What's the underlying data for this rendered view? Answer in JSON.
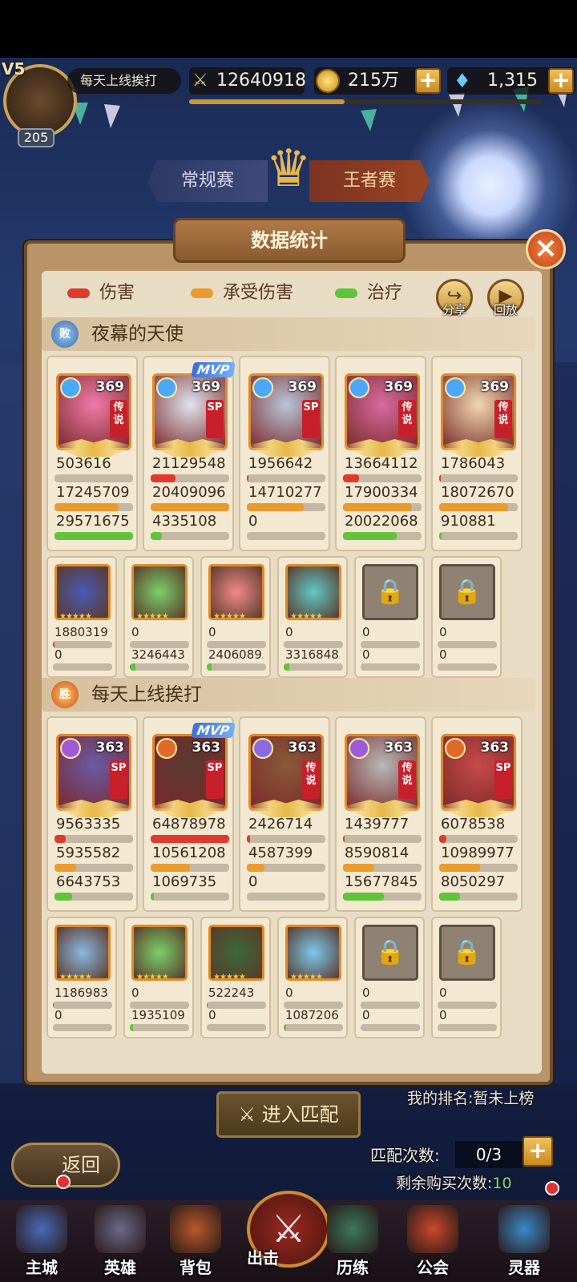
{
  "player": {
    "vip": "V5",
    "level": "205",
    "name": "每天上线挨打",
    "power": "12640918",
    "gold": "215万",
    "gems": "1,315"
  },
  "tabs": [
    "常规赛",
    "王者赛"
  ],
  "panel": {
    "title": "数据统计",
    "close": "×"
  },
  "legend": [
    {
      "label": "伤害",
      "color": "#e03a2e"
    },
    {
      "label": "承受伤害",
      "color": "#eb9a2e"
    },
    {
      "label": "治疗",
      "color": "#5fc43a"
    }
  ],
  "buttons": {
    "share": "分享",
    "replay": "回放"
  },
  "teams": [
    {
      "result": "败",
      "name": "夜幕的天使",
      "heroes": [
        {
          "level": "369",
          "rank": "传说",
          "mvp": "",
          "damage": "503616",
          "taken": "17245709",
          "heal": "29571675",
          "dmg_frac": 0.0,
          "taken_frac": 0.82,
          "heal_frac": 1.0,
          "element": "#4aa8ff",
          "art": "#f07aa8"
        },
        {
          "level": "369",
          "rank": "SP",
          "mvp": "MVP",
          "damage": "21129548",
          "taken": "20409096",
          "heal": "4335108",
          "dmg_frac": 0.32,
          "taken_frac": 1.0,
          "heal_frac": 0.14,
          "element": "#4aa8ff",
          "art": "#dfe4ee"
        },
        {
          "level": "369",
          "rank": "SP",
          "mvp": "",
          "damage": "1956642",
          "taken": "14710277",
          "heal": "0",
          "dmg_frac": 0.02,
          "taken_frac": 0.72,
          "heal_frac": 0.0,
          "element": "#4aa8ff",
          "art": "#b8c4d8"
        },
        {
          "level": "369",
          "rank": "传说",
          "mvp": "",
          "damage": "13664112",
          "taken": "17900334",
          "heal": "20022068",
          "dmg_frac": 0.2,
          "taken_frac": 0.88,
          "heal_frac": 0.68,
          "element": "#4aa8ff",
          "art": "#d86aa0"
        },
        {
          "level": "369",
          "rank": "传说",
          "mvp": "",
          "damage": "1786043",
          "taken": "18072670",
          "heal": "910881",
          "dmg_frac": 0.02,
          "taken_frac": 0.88,
          "heal_frac": 0.03,
          "element": "#4aa8ff",
          "art": "#f0d8b0"
        }
      ],
      "pets": [
        {
          "damage": "1880319",
          "heal": "0",
          "dmg_frac": 0.03,
          "heal_frac": 0.0,
          "locked": false,
          "art": "#4a5ab8"
        },
        {
          "damage": "0",
          "heal": "3246443",
          "dmg_frac": 0.0,
          "heal_frac": 0.1,
          "locked": false,
          "art": "#7ad06a"
        },
        {
          "damage": "0",
          "heal": "2406089",
          "dmg_frac": 0.0,
          "heal_frac": 0.08,
          "locked": false,
          "art": "#f08a8a"
        },
        {
          "damage": "0",
          "heal": "3316848",
          "dmg_frac": 0.0,
          "heal_frac": 0.1,
          "locked": false,
          "art": "#60c8c8"
        },
        {
          "damage": "0",
          "heal": "0",
          "dmg_frac": 0.0,
          "heal_frac": 0.0,
          "locked": true,
          "art": ""
        },
        {
          "damage": "0",
          "heal": "0",
          "dmg_frac": 0.0,
          "heal_frac": 0.0,
          "locked": true,
          "art": ""
        },
        {
          "damage": "0",
          "heal": "0",
          "dmg_frac": 0.0,
          "heal_frac": 0.0,
          "locked": true,
          "art": ""
        }
      ]
    },
    {
      "result": "胜",
      "name": "每天上线挨打",
      "heroes": [
        {
          "level": "363",
          "rank": "SP",
          "mvp": "",
          "damage": "9563335",
          "taken": "5935582",
          "heal": "6643753",
          "dmg_frac": 0.14,
          "taken_frac": 0.28,
          "heal_frac": 0.22,
          "element": "#a05ad8",
          "art": "#6a5aa8"
        },
        {
          "level": "363",
          "rank": "SP",
          "mvp": "MVP",
          "damage": "64878978",
          "taken": "10561208",
          "heal": "1069735",
          "dmg_frac": 1.0,
          "taken_frac": 0.5,
          "heal_frac": 0.04,
          "element": "#e06a2a",
          "art": "#5a3a30"
        },
        {
          "level": "363",
          "rank": "传说",
          "mvp": "",
          "damage": "2426714",
          "taken": "4587399",
          "heal": "0",
          "dmg_frac": 0.04,
          "taken_frac": 0.22,
          "heal_frac": 0.0,
          "element": "#8a6ae0",
          "art": "#8a5a3a"
        },
        {
          "level": "363",
          "rank": "传说",
          "mvp": "",
          "damage": "1439777",
          "taken": "8590814",
          "heal": "15677845",
          "dmg_frac": 0.02,
          "taken_frac": 0.4,
          "heal_frac": 0.52,
          "element": "#a05ad8",
          "art": "#b8b8b8"
        },
        {
          "level": "363",
          "rank": "SP",
          "mvp": "",
          "damage": "6078538",
          "taken": "10989977",
          "heal": "8050297",
          "dmg_frac": 0.09,
          "taken_frac": 0.52,
          "heal_frac": 0.27,
          "element": "#e06a2a",
          "art": "#c84a4a"
        }
      ],
      "pets": [
        {
          "damage": "1186983",
          "heal": "0",
          "dmg_frac": 0.02,
          "heal_frac": 0.0,
          "locked": false,
          "art": "#8ab8e0"
        },
        {
          "damage": "0",
          "heal": "1935109",
          "dmg_frac": 0.0,
          "heal_frac": 0.06,
          "locked": false,
          "art": "#7ad06a"
        },
        {
          "damage": "522243",
          "heal": "0",
          "dmg_frac": 0.01,
          "heal_frac": 0.0,
          "locked": false,
          "art": "#3a6a3a"
        },
        {
          "damage": "0",
          "heal": "1087206",
          "dmg_frac": 0.0,
          "heal_frac": 0.04,
          "locked": false,
          "art": "#7ac8f0"
        },
        {
          "damage": "0",
          "heal": "0",
          "dmg_frac": 0.0,
          "heal_frac": 0.0,
          "locked": true,
          "art": ""
        },
        {
          "damage": "0",
          "heal": "0",
          "dmg_frac": 0.0,
          "heal_frac": 0.0,
          "locked": true,
          "art": ""
        },
        {
          "damage": "0",
          "heal": "0",
          "dmg_frac": 0.0,
          "heal_frac": 0.0,
          "locked": true,
          "art": ""
        }
      ]
    }
  ],
  "bottom": {
    "match_button": "进入匹配",
    "my_rank": "我的排名:暂未上榜",
    "back": "返回",
    "match_count_label": "匹配次数:",
    "match_count": "0/3",
    "buy_label": "剩余购买次数:",
    "buy_count": "10"
  },
  "nav": [
    {
      "label": "主城",
      "icon": "castle-icon",
      "color": "#4a6ab8"
    },
    {
      "label": "英雄",
      "icon": "helmet-icon",
      "color": "#6a6a8a"
    },
    {
      "label": "背包",
      "icon": "backpack-icon",
      "color": "#b85a2a"
    },
    {
      "label": "出击",
      "icon": "crossed-swords-icon",
      "color": "#9a2a20"
    },
    {
      "label": "历练",
      "icon": "tree-icon",
      "color": "#3a7a5a"
    },
    {
      "label": "公会",
      "icon": "guild-banner-icon",
      "color": "#c84a2a"
    },
    {
      "label": "灵器",
      "icon": "orb-icon",
      "color": "#3a8ac8"
    }
  ]
}
